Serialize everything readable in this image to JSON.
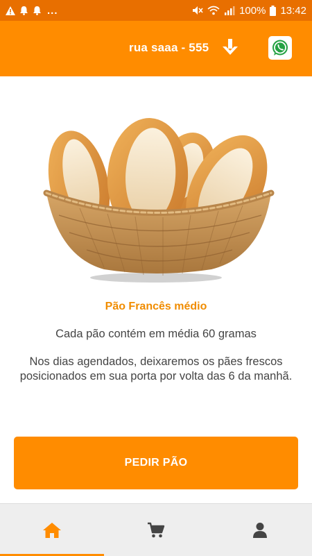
{
  "status_bar": {
    "left_icons": [
      "warning-icon",
      "bell-icon",
      "bell-icon"
    ],
    "overflow": "...",
    "battery": "100%",
    "time": "13:42"
  },
  "header": {
    "address": "rua saaa - 555",
    "address_icon": "arrow-down-icon",
    "contact_icon": "whatsapp-icon"
  },
  "product": {
    "image_icon": "bread-basket-image",
    "title": "Pão Francês médio",
    "description": "Cada pão contém em média 60 gramas",
    "delivery_note": "Nos dias agendados, deixaremos os pães frescos posicionados em sua porta por volta das 6 da manhã."
  },
  "action": {
    "order_label": "PEDIR PÃO"
  },
  "bottom_nav": {
    "items": [
      {
        "icon": "home-icon",
        "active": true
      },
      {
        "icon": "cart-icon",
        "active": false
      },
      {
        "icon": "user-icon",
        "active": false
      }
    ]
  },
  "colors": {
    "primary": "#ff8c00",
    "status_bar": "#e86f00",
    "title": "#f08c00",
    "nav_inactive": "#444444"
  }
}
